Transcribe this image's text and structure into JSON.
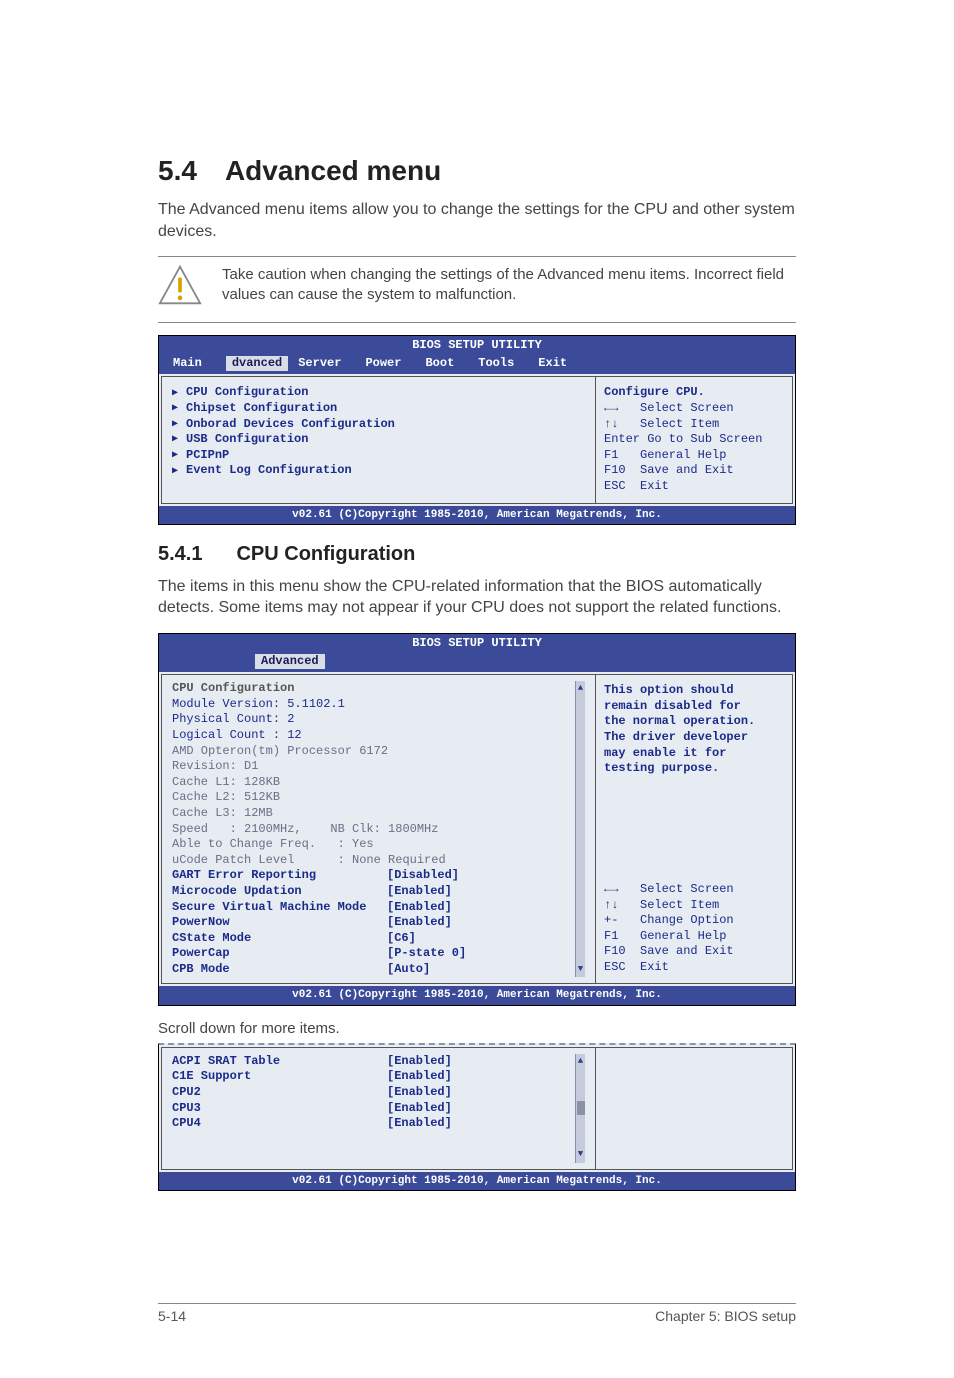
{
  "page": {
    "section_no": "5.4",
    "section_title": "Advanced menu",
    "intro": "The Advanced menu items allow you to change the settings for the CPU and other system devices.",
    "caution": "Take caution when changing the settings of the Advanced menu items. Incorrect field values can cause the system to malfunction.",
    "sub_no": "5.4.1",
    "sub_title": "CPU Configuration",
    "sub_intro": "The items in this menu show the CPU-related information that the BIOS automatically detects. Some items may not appear if your CPU does not support the related functions.",
    "scroll_note": "Scroll down for more items.",
    "footer_left": "5-14",
    "footer_right": "Chapter 5: BIOS setup"
  },
  "bios1": {
    "title": "BIOS SETUP UTILITY",
    "tabs": [
      "Main",
      "dvanced",
      "Server",
      "Power",
      "Boot",
      "Tools",
      "Exit"
    ],
    "active_tab_index": 1,
    "items": [
      "CPU Configuration",
      "Chipset Configuration",
      "Onborad Devices Configuration",
      "USB Configuration",
      "PCIPnP",
      "Event Log Configuration"
    ],
    "help_title": "Configure CPU.",
    "nav": [
      "←→   Select Screen",
      "↑↓   Select Item",
      "Enter Go to Sub Screen",
      "F1   General Help",
      "F10  Save and Exit",
      "ESC  Exit"
    ],
    "footer": "v02.61 (C)Copyright 1985-2010, American Megatrends, Inc."
  },
  "bios2": {
    "title": "BIOS SETUP UTILITY",
    "active_tab": "Advanced",
    "heading": "CPU Configuration",
    "info": [
      "Module Version: 5.1102.1",
      "Physical Count: 2",
      "Logical Count : 12",
      "",
      "AMD Opteron(tm) Processor 6172",
      "Revision: D1",
      "Cache L1: 128KB",
      "Cache L2: 512KB",
      "Cache L3: 12MB",
      "Speed   : 2100MHz,    NB Clk: 1800MHz",
      "Able to Change Freq.   : Yes",
      "uCode Patch Level      : None Required"
    ],
    "dim_indexes": [
      4,
      5,
      6,
      7,
      8,
      9,
      10,
      11
    ],
    "settings": [
      {
        "label": "GART Error Reporting",
        "value": "[Disabled]"
      },
      {
        "label": "Microcode Updation",
        "value": "[Enabled]"
      },
      {
        "label": "Secure Virtual Machine Mode",
        "value": "[Enabled]"
      },
      {
        "label": "PowerNow",
        "value": "[Enabled]"
      },
      {
        "label": "CState Mode",
        "value": "[C6]"
      },
      {
        "label": "PowerCap",
        "value": "[P-state 0]"
      },
      {
        "label": "CPB Mode",
        "value": "[Auto]"
      }
    ],
    "help": [
      "This option should",
      "remain disabled for",
      "the normal operation.",
      "The driver developer",
      "may enable it for",
      "testing purpose."
    ],
    "nav": [
      "←→   Select Screen",
      "↑↓   Select Item",
      "+-   Change Option",
      "F1   General Help",
      "F10  Save and Exit",
      "ESC  Exit"
    ],
    "footer": "v02.61 (C)Copyright 1985-2010, American Megatrends, Inc."
  },
  "bios3": {
    "settings": [
      {
        "label": "ACPI SRAT Table",
        "value": "[Enabled]"
      },
      {
        "label": "C1E Support",
        "value": "[Enabled]"
      },
      {
        "label": "CPU2",
        "value": "[Enabled]"
      },
      {
        "label": "CPU3",
        "value": "[Enabled]"
      },
      {
        "label": "CPU4",
        "value": "[Enabled]"
      }
    ],
    "footer": "v02.61 (C)Copyright 1985-2010, American Megatrends, Inc."
  }
}
